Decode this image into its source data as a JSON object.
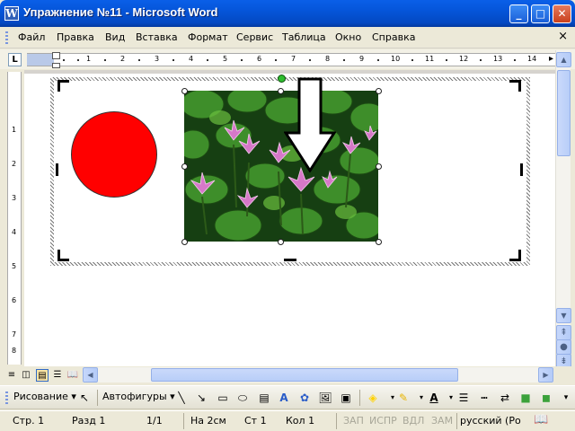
{
  "window": {
    "title": "Упражнение №11 - Microsoft Word",
    "minimize": "_",
    "maximize": "□",
    "close": "✕"
  },
  "menu": {
    "items": [
      "Файл",
      "Правка",
      "Вид",
      "Вставка",
      "Формат",
      "Сервис",
      "Таблица",
      "Окно",
      "Справка"
    ],
    "help_button": "×"
  },
  "ruler": {
    "tab_selector": "L",
    "numbers": [
      "1",
      "2",
      "3",
      "4",
      "5",
      "6",
      "7",
      "8",
      "9",
      "10",
      "11",
      "12",
      "13",
      "14"
    ],
    "vertical_numbers": [
      "1",
      "2",
      "3",
      "4",
      "5",
      "6",
      "7",
      "8"
    ]
  },
  "drawing_toolbar": {
    "draw_label": "Рисование",
    "autoshapes_label": "Автофигуры"
  },
  "status": {
    "page": "Стр. 1",
    "section": "Разд 1",
    "page_of": "1/1",
    "at": "На 2см",
    "line": "Ст 1",
    "col": "Кол 1",
    "rec": "ЗАП",
    "trk": "ИСПР",
    "ext": "ВДЛ",
    "ovr": "ЗАМ",
    "language": "русский (Ро"
  },
  "colors": {
    "circle_fill": "#FF0000",
    "arrow_fill": "#FFFFFF",
    "titlebar": "#0555D9"
  }
}
